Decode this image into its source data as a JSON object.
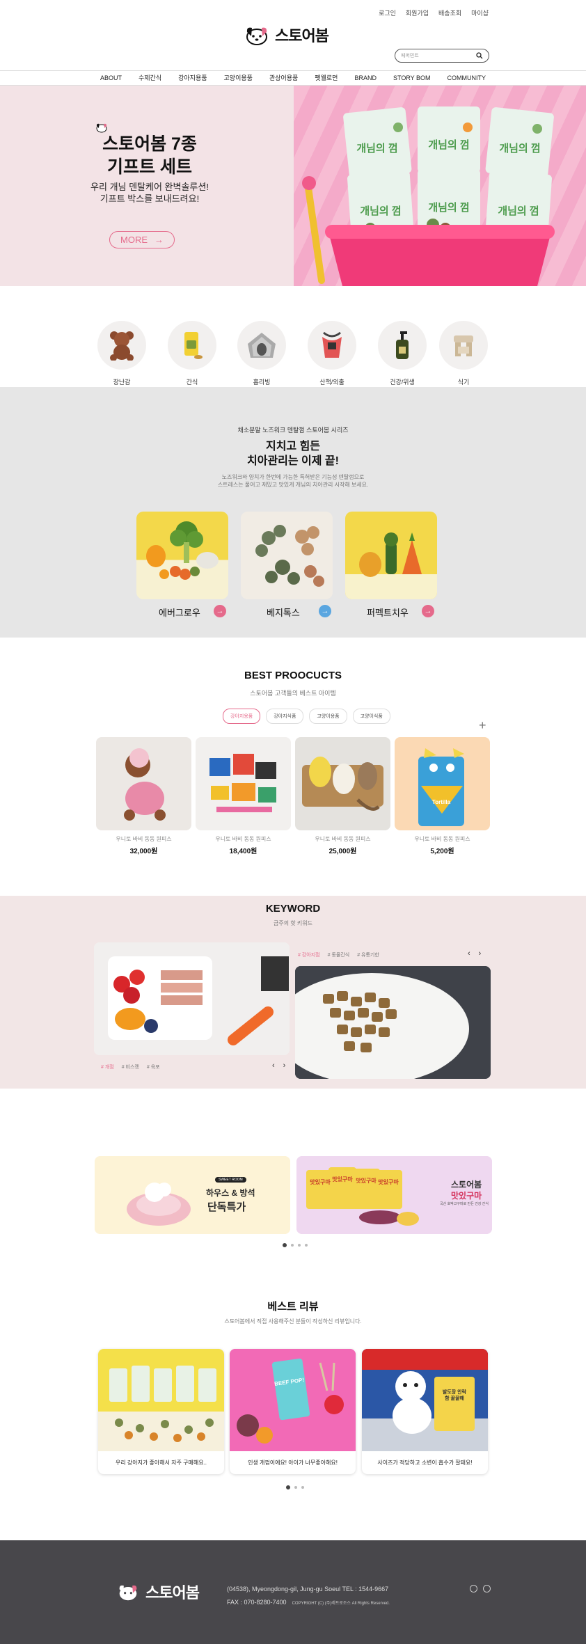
{
  "header": {
    "top_links": [
      "로그인",
      "회원가입",
      "배송조회",
      "마이샵"
    ],
    "logo_text": "스토어봄",
    "search_placeholder": "페퍼민트",
    "nav": [
      "ABOUT",
      "수제간식",
      "강아지용품",
      "고양이용품",
      "관상어용품",
      "펫웰로먼",
      "BRAND",
      "STORY BOM",
      "COMMUNITY"
    ]
  },
  "hero": {
    "title_line1": "스토어봄 7종",
    "title_line2": "기프트 세트",
    "sub_line1": "우리 개님 덴탈케어 완벽솔루션!",
    "sub_line2": "기프트 박스를 보내드려요!",
    "more_label": "MORE",
    "pack_label": "개님의 껌"
  },
  "categories": [
    {
      "label": "장난감",
      "icon": "teddy-bear-icon"
    },
    {
      "label": "간식",
      "icon": "snack-icon"
    },
    {
      "label": "홈리빙",
      "icon": "pet-house-icon"
    },
    {
      "label": "산책/외출",
      "icon": "harness-icon"
    },
    {
      "label": "건강/위생",
      "icon": "pump-bottle-icon"
    },
    {
      "label": "식기",
      "icon": "bowl-stand-icon"
    }
  ],
  "dental": {
    "small": "채소분말 노즈워크 덴탈껌 스토어봄 시리즈",
    "title_line1": "지치고 힘든",
    "title_line2": "치아관리는 이제 끝!",
    "desc_line1": "노즈워크와 양치가 한번에 가능한 특허받은 기능성 덴탈껌으로",
    "desc_line2": "스트레스는 풀어고 재밌고 맛있게 개님의 치아관리 시작해 보세요.",
    "items": [
      {
        "label": "에버그로우",
        "arrow_color": "#e56a8b"
      },
      {
        "label": "베지톡스",
        "arrow_color": "#5aa6e0"
      },
      {
        "label": "퍼펙트치우",
        "arrow_color": "#e56a8b"
      }
    ]
  },
  "best": {
    "title": "BEST PROOCUCTS",
    "sub": "스토어봄 고객들의 베스트 아이템",
    "tabs": [
      "강아지용품",
      "강아지식품",
      "고양이용품",
      "고양이식품"
    ],
    "plus": "+",
    "products": [
      {
        "name": "우니토 바비 동동 원피스",
        "price": "32,000원"
      },
      {
        "name": "우니토 바비 동동 원피스",
        "price": "18,400원"
      },
      {
        "name": "우니토 바비 동동 원피스",
        "price": "25,000원"
      },
      {
        "name": "우니토 바비 동동 원피스",
        "price": "5,200원"
      }
    ],
    "toy_text": "Tortilla"
  },
  "keyword": {
    "title": "KEYWORD",
    "sub": "금주의 핫 키워드",
    "left_tabs": [
      "# 개껌",
      "# 비스켓",
      "# 육포"
    ],
    "right_tabs": [
      "# 강아지껌",
      "# 동물간식",
      "# 유통기한"
    ],
    "prev": "‹",
    "next": "›"
  },
  "banners": {
    "left_small": "SWEET ROOM",
    "left_line1": "하우스 & 방석",
    "left_line2": "단독특가",
    "right_line1": "스토어봄",
    "right_line2": "맛있구마",
    "right_desc": "국산 호박고구마로 만든 건강 간식",
    "pack_label": "맛있구마"
  },
  "reviews": {
    "title": "베스트 리뷰",
    "sub": "스토어봄에서 직접 사용해주신 분들이 작성하신 리뷰입니다.",
    "items": [
      {
        "text": "우리 강아지가 좋아해서 자주 구매해요.."
      },
      {
        "text": "인생 개껌이에요! 아이가 너무좋아해요!"
      },
      {
        "text": "사이즈가 적당하고 소변이 흡수가 잘돼요!"
      }
    ],
    "beef_label": "BEEF POP!",
    "pad_label": "발도장 안락함 꿀꿀해"
  },
  "footer": {
    "logo_text": "스토어봄",
    "address": "(04538), Myeongdong-gil, Jung-gu Soeul   TEL : 1544-9667",
    "fax": "FAX : 070-8280-7400",
    "copyright": "COPYRIGHT (C) (주)레트로조스 All Rights Reserved."
  },
  "colors": {
    "accent": "#e56a8b",
    "blue": "#5aa6e0",
    "footer": "#48474b"
  }
}
